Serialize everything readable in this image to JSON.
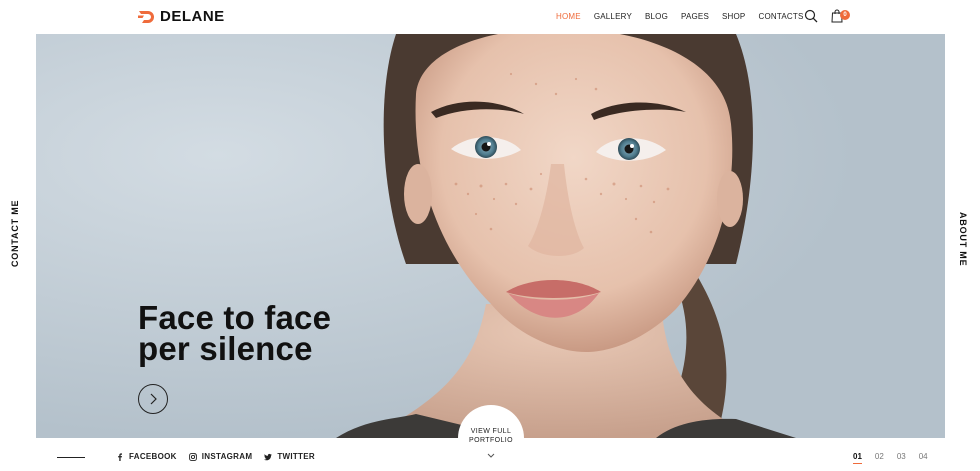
{
  "brand": {
    "name": "DELANE",
    "accent": "#ef6b3b"
  },
  "nav": {
    "items": [
      {
        "label": "HOME",
        "active": true
      },
      {
        "label": "GALLERY",
        "active": false
      },
      {
        "label": "BLOG",
        "active": false
      },
      {
        "label": "PAGES",
        "active": false
      },
      {
        "label": "SHOP",
        "active": false
      },
      {
        "label": "CONTACTS",
        "active": false
      }
    ],
    "cart_count": "0"
  },
  "side": {
    "left_label": "CONTACT ME",
    "right_label": "ABOUT ME"
  },
  "hero": {
    "headline_line1": "Face to face",
    "headline_line2": "per silence"
  },
  "portfolio": {
    "line1": "VIEW FULL",
    "line2": "PORTFOLIO"
  },
  "social": [
    {
      "label": "FACEBOOK",
      "icon": "facebook-icon"
    },
    {
      "label": "INSTAGRAM",
      "icon": "instagram-icon"
    },
    {
      "label": "TWITTER",
      "icon": "twitter-icon"
    }
  ],
  "pager": [
    {
      "label": "01",
      "active": true
    },
    {
      "label": "02",
      "active": false
    },
    {
      "label": "03",
      "active": false
    },
    {
      "label": "04",
      "active": false
    }
  ]
}
